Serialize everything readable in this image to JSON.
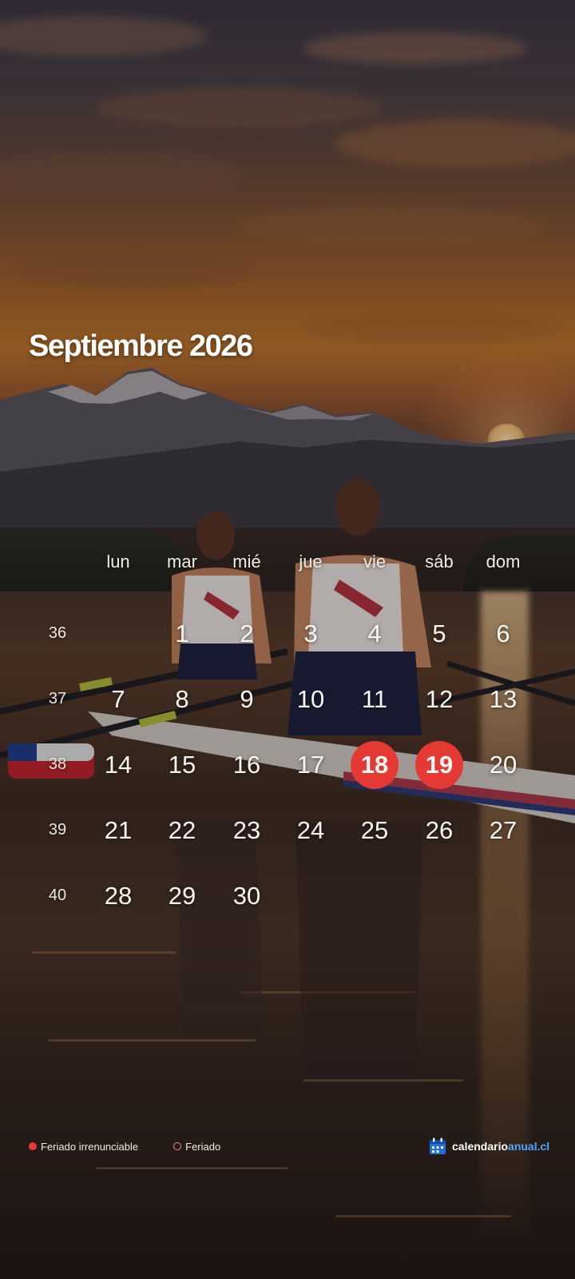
{
  "title": "Septiembre 2026",
  "weekdays": [
    "lun",
    "mar",
    "mié",
    "jue",
    "vie",
    "sáb",
    "dom"
  ],
  "weeks": [
    {
      "number": "36",
      "days": [
        "",
        "1",
        "2",
        "3",
        "4",
        "5",
        "6"
      ]
    },
    {
      "number": "37",
      "days": [
        "7",
        "8",
        "9",
        "10",
        "11",
        "12",
        "13"
      ]
    },
    {
      "number": "38",
      "days": [
        "14",
        "15",
        "16",
        "17",
        "18",
        "19",
        "20"
      ]
    },
    {
      "number": "39",
      "days": [
        "21",
        "22",
        "23",
        "24",
        "25",
        "26",
        "27"
      ]
    },
    {
      "number": "40",
      "days": [
        "28",
        "29",
        "30",
        "",
        "",
        "",
        ""
      ]
    }
  ],
  "holidays_irrenunciables": [
    "18",
    "19"
  ],
  "legend": {
    "irrenunciable": "Feriado irrenunciable",
    "feriado": "Feriado"
  },
  "brand": {
    "part1": "calendario",
    "part2": "anual.cl"
  },
  "colors": {
    "holiday": "#e53935",
    "brand_accent": "#4aa8ff",
    "feriado_ring": "#e88a9a"
  },
  "icons": {
    "brand": "calendar-icon"
  }
}
